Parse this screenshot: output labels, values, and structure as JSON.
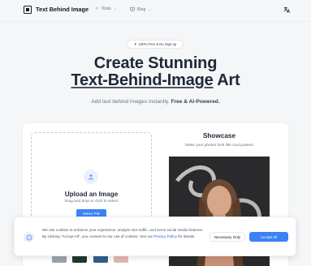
{
  "header": {
    "brand": "Text Behind Image",
    "nav": [
      {
        "label": "Tools",
        "icon": "sparkle-icon"
      },
      {
        "label": "Blog",
        "icon": "book-icon"
      }
    ],
    "language_icon": "translate-icon"
  },
  "hero": {
    "badge": "100% Free & No Sign-up",
    "title_line1": "Create Stunning",
    "title_line2": "Text-Behind-Image",
    "title_line2_rest": " Art",
    "subtitle_prefix": "Add text behind images instantly. ",
    "subtitle_bold": "Free & AI-Powered."
  },
  "upload": {
    "title": "Upload an Image",
    "subtitle": "Drag and drop or click to select",
    "button": "Select File"
  },
  "showcase": {
    "title": "Showcase",
    "subtitle": "Make your photos look like cool posters"
  },
  "cookie": {
    "text_before_link": "We use cookies to enhance your experience, analyze site traffic, and serve social media features. By clicking \"Accept All\", you consent to our use of cookies. See our ",
    "link": "Privacy Policy",
    "text_after_link": " for details.",
    "necessary_button": "Necessary Only",
    "accept_button": "Accept All"
  },
  "colors": {
    "accent": "#3b82f6",
    "background": "#f5f6f7",
    "heading": "#1f2937"
  }
}
